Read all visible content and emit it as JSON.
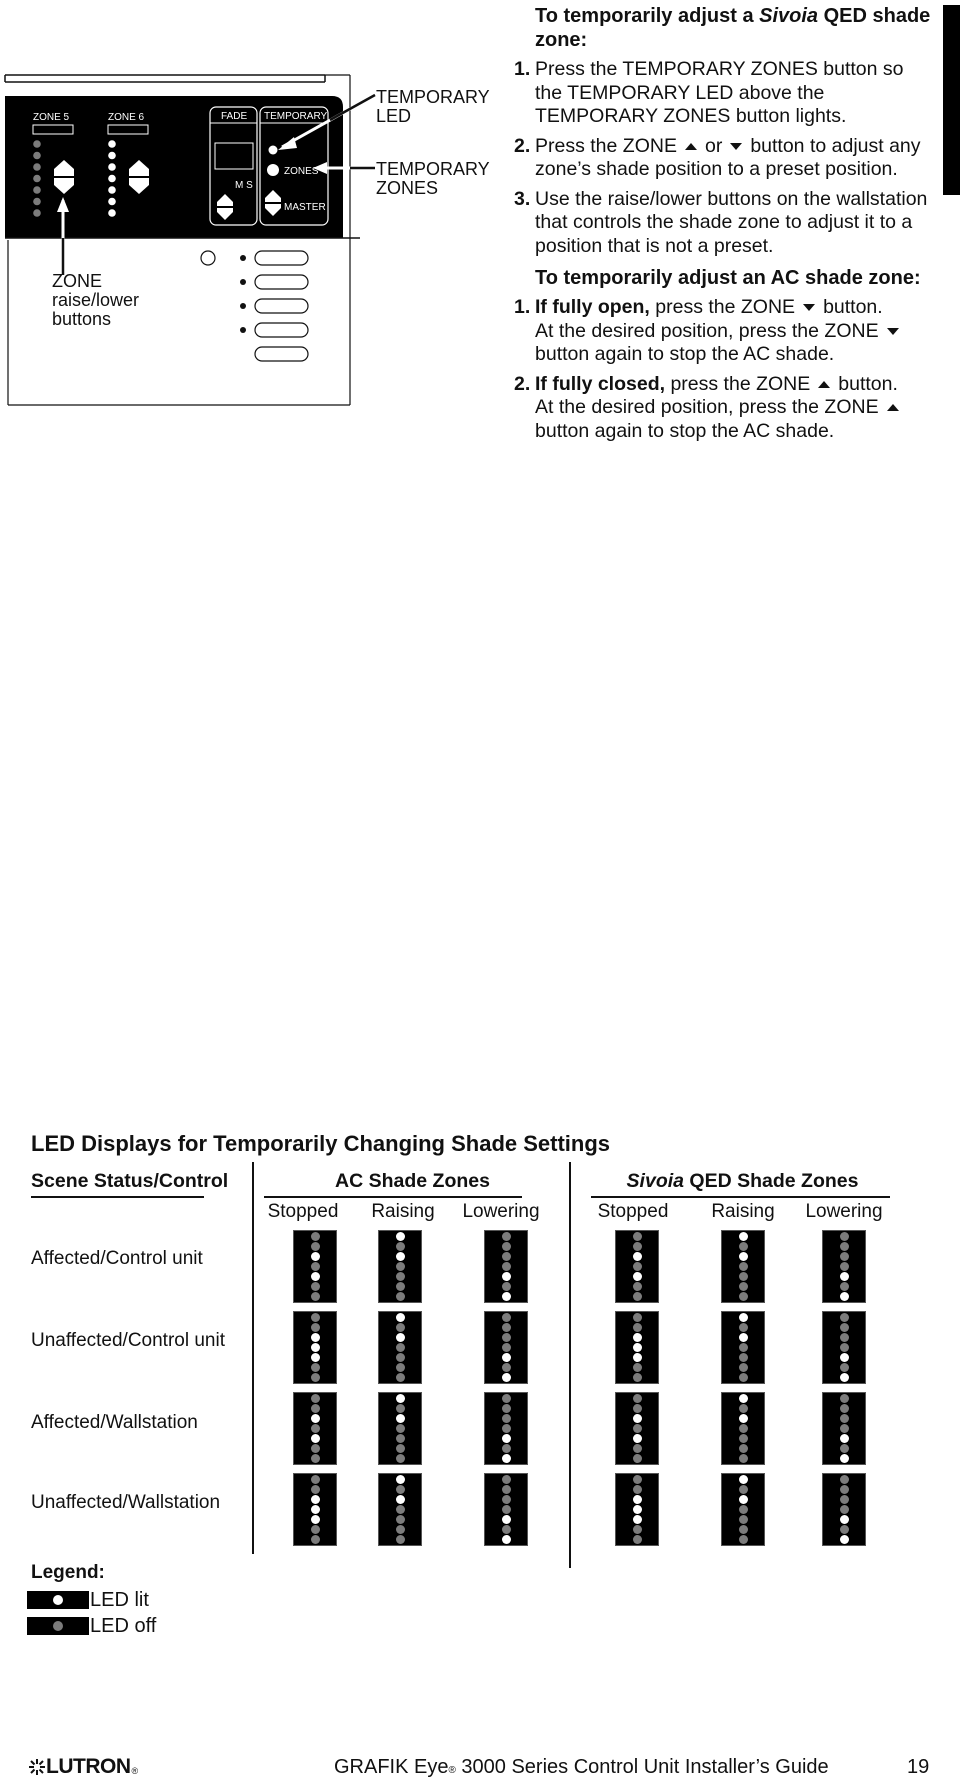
{
  "diagram": {
    "panel_labels": {
      "zone5": "ZONE 5",
      "zone6": "ZONE  6",
      "fade": "FADE",
      "temporary": "TEMPORARY",
      "zones": "ZONES",
      "ms": "M S",
      "master": "MASTER"
    },
    "callouts": {
      "temporary_led": "TEMPORARY\nLED",
      "temporary_zones": "TEMPORARY\nZONES",
      "zone_buttons": "ZONE\nraise/lower\nbuttons"
    },
    "zone5_leds": [
      false,
      false,
      false,
      false,
      false,
      false,
      false
    ],
    "zone6_leds": [
      true,
      true,
      true,
      true,
      true,
      true,
      true
    ]
  },
  "instructions": {
    "sivoia_heading": {
      "pre": "To temporarily adjust a ",
      "italic": "Sivoia",
      "post": " QED shade zone:"
    },
    "sivoia_steps": [
      {
        "num": "1.",
        "text": "Press the TEMPORARY ZONES button so the TEMPORARY LED above the TEMPORARY ZONES button lights."
      },
      {
        "num": "2.",
        "pre": "Press the ZONE",
        "mid": "or",
        "post": "button to adjust any zone’s shade position to a preset position."
      },
      {
        "num": "3.",
        "text": "Use the raise/lower buttons on the wallstation that controls the shade zone to adjust it to a position that is not a preset."
      }
    ],
    "ac_heading": "To temporarily adjust an AC shade zone:",
    "ac_steps": [
      {
        "num": "1.",
        "bold": "If fully open,",
        "pre": " press the ZONE",
        "post": "button.",
        "line2": "At the desired position, press the ZONE",
        "line3": "button again to stop the AC shade."
      },
      {
        "num": "2.",
        "bold": "If fully closed,",
        "pre": " press the ZONE",
        "post": "button.",
        "line2": "At the desired position, press the ZONE",
        "line3": "button again to stop the AC shade."
      }
    ]
  },
  "led_table": {
    "title": "LED Displays for Temporarily Changing Shade Settings",
    "scene_header": "Scene Status/Control",
    "ac_header": "AC Shade Zones",
    "qed_header_italic": "Sivoia",
    "qed_header_rest": " QED Shade Zones",
    "states": [
      "Stopped",
      "Raising",
      "Lowering"
    ],
    "rows": [
      {
        "label": "Affected/Control unit",
        "ac": [
          [
            0,
            0,
            1,
            0,
            1,
            0,
            0
          ],
          [
            1,
            0,
            1,
            0,
            0,
            0,
            0
          ],
          [
            0,
            0,
            0,
            0,
            1,
            0,
            1
          ]
        ],
        "qed": [
          [
            0,
            0,
            1,
            0,
            1,
            0,
            0
          ],
          [
            1,
            0,
            1,
            0,
            0,
            0,
            0
          ],
          [
            0,
            0,
            0,
            0,
            1,
            0,
            1
          ]
        ]
      },
      {
        "label": "Unaffected/Control unit",
        "ac": [
          [
            0,
            0,
            1,
            1,
            1,
            0,
            0
          ],
          [
            1,
            0,
            1,
            0,
            0,
            0,
            0
          ],
          [
            0,
            0,
            0,
            0,
            1,
            0,
            1
          ]
        ],
        "qed": [
          [
            0,
            0,
            1,
            1,
            1,
            0,
            0
          ],
          [
            1,
            0,
            1,
            0,
            0,
            0,
            0
          ],
          [
            0,
            0,
            0,
            0,
            1,
            0,
            1
          ]
        ]
      },
      {
        "label": "Affected/Wallstation",
        "ac": [
          [
            0,
            0,
            1,
            0,
            1,
            0,
            0
          ],
          [
            1,
            0,
            1,
            0,
            0,
            0,
            0
          ],
          [
            0,
            0,
            0,
            0,
            1,
            0,
            1
          ]
        ],
        "qed": [
          [
            0,
            0,
            1,
            0,
            1,
            0,
            0
          ],
          [
            1,
            0,
            1,
            0,
            0,
            0,
            0
          ],
          [
            0,
            0,
            0,
            0,
            1,
            0,
            1
          ]
        ]
      },
      {
        "label": "Unaffected/Wallstation",
        "ac": [
          [
            0,
            0,
            1,
            1,
            1,
            0,
            0
          ],
          [
            1,
            0,
            1,
            0,
            0,
            0,
            0
          ],
          [
            0,
            0,
            0,
            0,
            1,
            0,
            1
          ]
        ],
        "qed": [
          [
            0,
            0,
            1,
            1,
            1,
            0,
            0
          ],
          [
            1,
            0,
            1,
            0,
            0,
            0,
            0
          ],
          [
            0,
            0,
            0,
            0,
            1,
            0,
            1
          ]
        ]
      }
    ],
    "legend": {
      "title": "Legend:",
      "lit": "LED lit",
      "off": "LED off"
    }
  },
  "footer": {
    "brand": "LUTRON",
    "brand_mark": "®",
    "title_pre": "GRAFIK Eye",
    "title_mark": "®",
    "title_post": " 3000 Series Control Unit Installer’s Guide",
    "page": "19"
  },
  "colors": {
    "led_lit": "#ffffff",
    "led_off": "#7c7c7c",
    "panel": "#000000"
  }
}
